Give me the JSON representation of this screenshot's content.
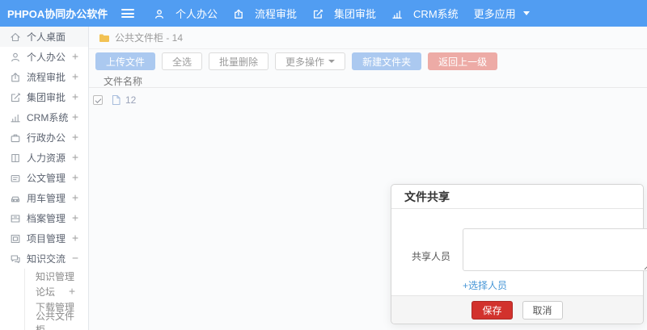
{
  "topbar": {
    "logo": "PHPOA协同办公软件",
    "nav": [
      {
        "label": "个人办公"
      },
      {
        "label": "流程审批"
      },
      {
        "label": "集团审批"
      },
      {
        "label": "CRM系统"
      },
      {
        "label": "更多应用"
      }
    ]
  },
  "sidebar": {
    "items": [
      {
        "label": "个人桌面",
        "expand": ""
      },
      {
        "label": "个人办公",
        "expand": "+"
      },
      {
        "label": "流程审批",
        "expand": "+"
      },
      {
        "label": "集团审批",
        "expand": "+"
      },
      {
        "label": "CRM系统",
        "expand": "+"
      },
      {
        "label": "行政办公",
        "expand": "+"
      },
      {
        "label": "人力资源",
        "expand": "+"
      },
      {
        "label": "公文管理",
        "expand": "+"
      },
      {
        "label": "用车管理",
        "expand": "+"
      },
      {
        "label": "档案管理",
        "expand": "+"
      },
      {
        "label": "项目管理",
        "expand": "+"
      },
      {
        "label": "知识交流",
        "expand": "−"
      }
    ],
    "subitems": [
      {
        "label": "知识管理",
        "expand": ""
      },
      {
        "label": "论坛",
        "expand": "+"
      },
      {
        "label": "下载管理",
        "expand": ""
      },
      {
        "label": "公共文件柜",
        "expand": ""
      }
    ]
  },
  "breadcrumb": {
    "label": "公共文件柜 - 14"
  },
  "toolbar": {
    "upload": "上传文件",
    "select_all": "全选",
    "batch_delete": "批量删除",
    "more_actions": "更多操作",
    "new_folder": "新建文件夹",
    "back": "返回上一级"
  },
  "files": {
    "header": "文件名称",
    "rows": [
      {
        "name": "12",
        "checked": true
      }
    ]
  },
  "modal": {
    "title": "文件共享",
    "field_label": "共享人员",
    "textarea_value": "",
    "select_link": "+选择人员",
    "save_label": "保存",
    "cancel_label": "取消"
  },
  "colors": {
    "topbar_blue": "#519df2",
    "primary_muted": "#abc9f0",
    "danger_muted": "#edaba6",
    "save_red": "#d2322d",
    "link_blue": "#4796d6",
    "folder_yellow": "#f2c254"
  }
}
